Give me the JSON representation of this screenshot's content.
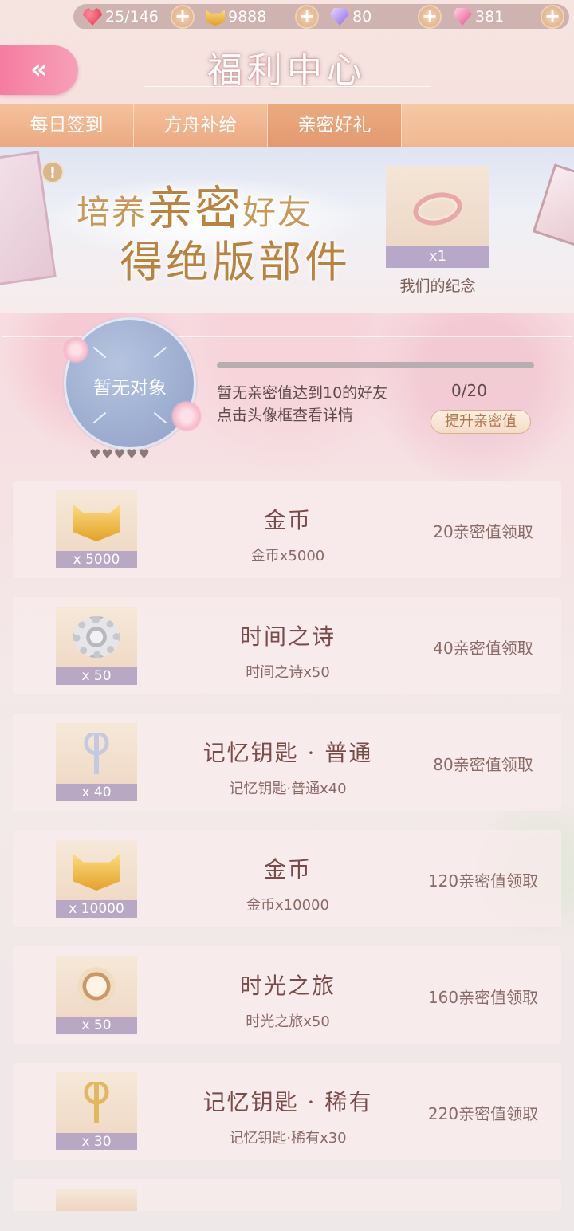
{
  "topbar": {
    "stamina": "25/146",
    "coins": "9888",
    "diamonds": "80",
    "pink_diamonds": "381",
    "plus": "+"
  },
  "header": {
    "back": "«",
    "title": "福利中心"
  },
  "tabs": [
    {
      "label": "每日签到",
      "active": false
    },
    {
      "label": "方舟补给",
      "active": false
    },
    {
      "label": "亲密好礼",
      "active": true
    }
  ],
  "banner": {
    "info": "!",
    "line1_a": "培养",
    "line1_b": "亲密",
    "line1_c": "好友",
    "line2": "得绝版部件",
    "reward_qty": "x1",
    "reward_name": "我们的纪念"
  },
  "partner": {
    "avatar_text": "暂无对象",
    "hearts": "♥♥♥♥♥",
    "desc1": "暂无亲密值达到10的好友",
    "desc2": "点击头像框查看详情",
    "count": "0/20",
    "progress": 0,
    "boost_label": "提升亲密值"
  },
  "rewards": [
    {
      "art": "coin",
      "qty": "x 5000",
      "title": "金币",
      "sub": "金币x5000",
      "claim": "20亲密值领取"
    },
    {
      "art": "gear",
      "qty": "x 50",
      "title": "时间之诗",
      "sub": "时间之诗x50",
      "claim": "40亲密值领取"
    },
    {
      "art": "key",
      "qty": "x 40",
      "title": "记忆钥匙 · 普通",
      "sub": "记忆钥匙·普通x40",
      "claim": "80亲密值领取"
    },
    {
      "art": "coin",
      "qty": "x 10000",
      "title": "金币",
      "sub": "金币x10000",
      "claim": "120亲密值领取"
    },
    {
      "art": "watch",
      "qty": "x 50",
      "title": "时光之旅",
      "sub": "时光之旅x50",
      "claim": "160亲密值领取"
    },
    {
      "art": "key-gold",
      "qty": "x 30",
      "title": "记忆钥匙 · 稀有",
      "sub": "记忆钥匙·稀有x30",
      "claim": "220亲密值领取"
    }
  ]
}
